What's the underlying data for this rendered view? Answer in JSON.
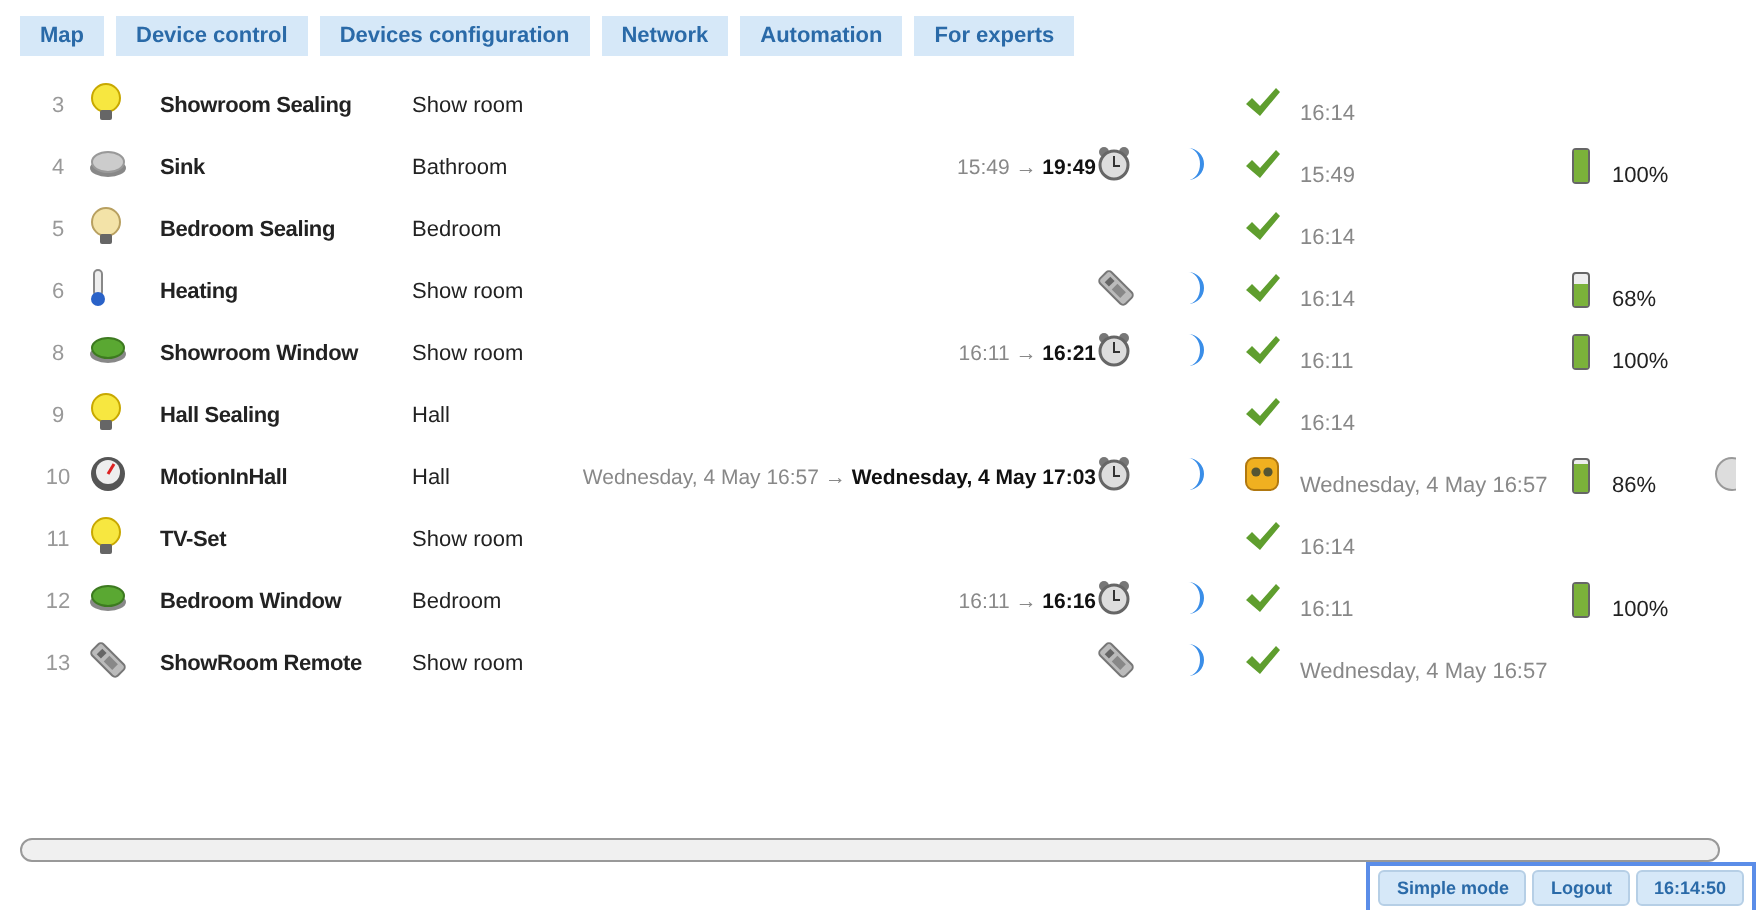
{
  "tabs": [
    {
      "label": "Map",
      "selected": false
    },
    {
      "label": "Device control",
      "selected": false
    },
    {
      "label": "Devices configuration",
      "selected": false
    },
    {
      "label": "Network",
      "selected": false
    },
    {
      "label": "Automation",
      "selected": false
    },
    {
      "label": "For experts",
      "selected": false
    }
  ],
  "devices": [
    {
      "number": "3",
      "kind": "bulb-on",
      "name": "Showroom Sealing",
      "room": "Show room",
      "status": {
        "kind": "ok",
        "time": "16:14"
      }
    },
    {
      "number": "4",
      "kind": "button-grey",
      "name": "Sink",
      "room": "Bathroom",
      "wake": {
        "kind": "alarm",
        "interval": "15:49 → **19:49**"
      },
      "sleeping": true,
      "status": {
        "kind": "ok",
        "time": "15:49"
      },
      "battery": {
        "level": 1.0,
        "text": "100%"
      }
    },
    {
      "number": "5",
      "kind": "bulb-dim",
      "name": "Bedroom Sealing",
      "room": "Bedroom",
      "status": {
        "kind": "ok",
        "time": "16:14"
      }
    },
    {
      "number": "6",
      "kind": "thermometer",
      "name": "Heating",
      "room": "Show room",
      "wake": {
        "kind": "remote"
      },
      "sleeping": true,
      "status": {
        "kind": "ok",
        "time": "16:14"
      },
      "battery": {
        "level": 0.68,
        "text": "68%"
      }
    },
    {
      "number": "8",
      "kind": "button-green",
      "name": "Showroom Window",
      "room": "Show room",
      "wake": {
        "kind": "alarm",
        "interval": "16:11 → **16:21**"
      },
      "sleeping": true,
      "status": {
        "kind": "ok",
        "time": "16:11"
      },
      "battery": {
        "level": 1.0,
        "text": "100%"
      }
    },
    {
      "number": "9",
      "kind": "bulb-on",
      "name": "Hall Sealing",
      "room": "Hall",
      "status": {
        "kind": "ok",
        "time": "16:14"
      }
    },
    {
      "number": "10",
      "kind": "gauge",
      "name": "MotionInHall",
      "room": "Hall",
      "wake": {
        "kind": "alarm",
        "interval": "Wednesday, 4 May 16:57 → **Wednesday, 4 May 17:03**"
      },
      "sleeping": true,
      "status": {
        "kind": "dead",
        "time": "Wednesday, 4 May 16:57"
      },
      "battery": {
        "level": 0.86,
        "text": "86%"
      },
      "extra_icon": true
    },
    {
      "number": "11",
      "kind": "bulb-on",
      "name": "TV-Set",
      "room": "Show room",
      "status": {
        "kind": "ok",
        "time": "16:14"
      }
    },
    {
      "number": "12",
      "kind": "button-green",
      "name": "Bedroom Window",
      "room": "Bedroom",
      "wake": {
        "kind": "alarm",
        "interval": "16:11 → **16:16**"
      },
      "sleeping": true,
      "status": {
        "kind": "ok",
        "time": "16:11"
      },
      "battery": {
        "level": 1.0,
        "text": "100%"
      }
    },
    {
      "number": "13",
      "kind": "remote",
      "name": "ShowRoom Remote",
      "room": "Show room",
      "wake": {
        "kind": "remote"
      },
      "sleeping": true,
      "status": {
        "kind": "ok",
        "time": "Wednesday, 4 May 16:57"
      }
    }
  ],
  "footer_buttons": [
    "Simple mode",
    "Logout",
    "16:14:50"
  ]
}
